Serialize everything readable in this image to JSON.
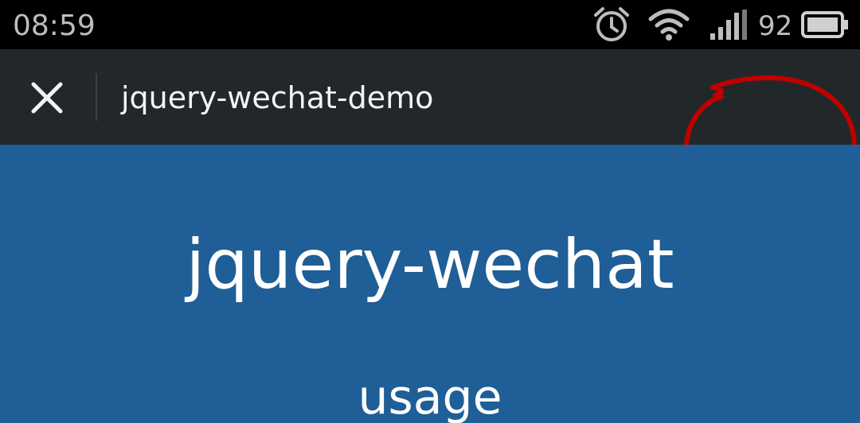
{
  "status_bar": {
    "time": "08:59",
    "battery_level": "92",
    "icons": [
      "alarm-icon",
      "wifi-icon",
      "signal-icon",
      "battery-icon"
    ]
  },
  "top_bar": {
    "close_icon": "close-icon",
    "title": "jquery-wechat-demo"
  },
  "content": {
    "hero_title": "jquery-wechat",
    "usage_link": "usage"
  },
  "colors": {
    "status_bar_bg": "#000000",
    "top_bar_bg": "#22282a",
    "content_bg": "#1f5e96",
    "annotation": "#c00000"
  }
}
